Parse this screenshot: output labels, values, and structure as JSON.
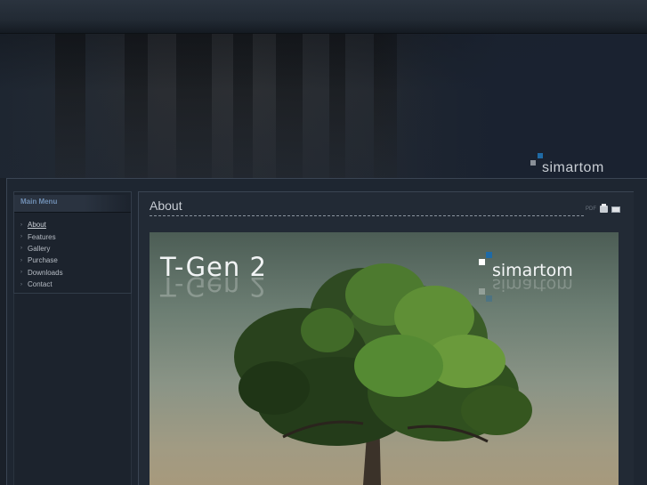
{
  "header": {
    "brand_name": "simartom"
  },
  "sidebar": {
    "title": "Main Menu",
    "items": [
      {
        "label": "About",
        "active": true
      },
      {
        "label": "Features",
        "active": false
      },
      {
        "label": "Gallery",
        "active": false
      },
      {
        "label": "Purchase",
        "active": false
      },
      {
        "label": "Downloads",
        "active": false
      },
      {
        "label": "Contact",
        "active": false
      }
    ]
  },
  "content": {
    "title": "About",
    "icons": [
      "pdf-icon",
      "print-icon",
      "email-icon"
    ],
    "pdf_label": "PDF",
    "hero": {
      "title": "T-Gen 2",
      "brand": "simartom"
    }
  },
  "colors": {
    "accent": "#1f6aa5",
    "menu_title": "#6f8eb3",
    "background": "#1a2029"
  }
}
